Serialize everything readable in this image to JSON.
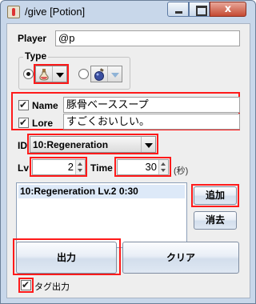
{
  "window": {
    "title": "/give [Potion]",
    "close_glyph": "x"
  },
  "player": {
    "label": "Player",
    "value": "@p"
  },
  "type": {
    "label": "Type",
    "options": [
      {
        "icon": "potion-bottle-icon",
        "selected": true
      },
      {
        "icon": "splash-potion-icon",
        "selected": false,
        "enabled": false
      }
    ]
  },
  "name": {
    "label": "Name",
    "checked": true,
    "value": "豚骨ベーススープ"
  },
  "lore": {
    "label": "Lore",
    "checked": true,
    "value": "すごくおいしい。"
  },
  "id": {
    "label": "ID",
    "selected": "10:Regeneration"
  },
  "lv": {
    "label": "Lv",
    "value": "2"
  },
  "time": {
    "label": "Time",
    "value": "30",
    "unit": "(秒)"
  },
  "effects_list": {
    "items": [
      "10:Regeneration Lv.2  0:30"
    ]
  },
  "buttons": {
    "add": "追加",
    "delete": "消去",
    "output": "出力",
    "clear": "クリア"
  },
  "tag_output": {
    "label": "タグ出力",
    "checked": true
  },
  "colors": {
    "highlight": "#ff1a1a",
    "window_frame": "#c8d7ea",
    "client_bg": "#eeeeee"
  }
}
